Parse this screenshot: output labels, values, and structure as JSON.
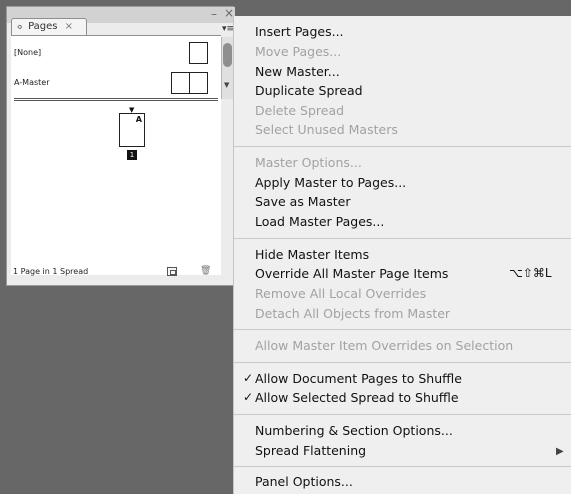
{
  "panel": {
    "tab_label": "Pages",
    "tab_arrows": "≎",
    "tab_close": "×",
    "collapse_glyph": "–",
    "close_glyph": "×",
    "menu_glyph": "▾≡",
    "masters": [
      {
        "label": "[None]"
      },
      {
        "label": "A-Master"
      }
    ],
    "doc_page_prefix": "A",
    "doc_page_number": "1",
    "status_text": "1 Page in 1 Spread"
  },
  "menu": {
    "items": [
      {
        "label": "Insert Pages...",
        "state": "enabled"
      },
      {
        "label": "Move Pages...",
        "state": "disabled"
      },
      {
        "label": "New Master...",
        "state": "enabled"
      },
      {
        "label": "Duplicate Spread",
        "state": "enabled"
      },
      {
        "label": "Delete Spread",
        "state": "disabled"
      },
      {
        "label": "Select Unused Masters",
        "state": "disabled"
      },
      {
        "label": "Master Options...",
        "state": "disabled"
      },
      {
        "label": "Apply Master to Pages...",
        "state": "enabled"
      },
      {
        "label": "Save as Master",
        "state": "enabled"
      },
      {
        "label": "Load Master Pages...",
        "state": "enabled"
      },
      {
        "label": "Hide Master Items",
        "state": "enabled"
      },
      {
        "label": "Override All Master Page Items",
        "state": "enabled",
        "shortcut": "⌥⇧⌘L"
      },
      {
        "label": "Remove All Local Overrides",
        "state": "disabled"
      },
      {
        "label": "Detach All Objects from Master",
        "state": "disabled"
      },
      {
        "label": "Allow Master Item Overrides on Selection",
        "state": "disabled"
      },
      {
        "label": "Allow Document Pages to Shuffle",
        "state": "enabled",
        "checked": true
      },
      {
        "label": "Allow Selected Spread to Shuffle",
        "state": "enabled",
        "checked": true
      },
      {
        "label": "Numbering & Section Options...",
        "state": "enabled"
      },
      {
        "label": "Spread Flattening",
        "state": "enabled",
        "submenu": true
      },
      {
        "label": "Panel Options...",
        "state": "enabled"
      }
    ],
    "check_glyph": "✓",
    "submenu_glyph": "▶"
  }
}
